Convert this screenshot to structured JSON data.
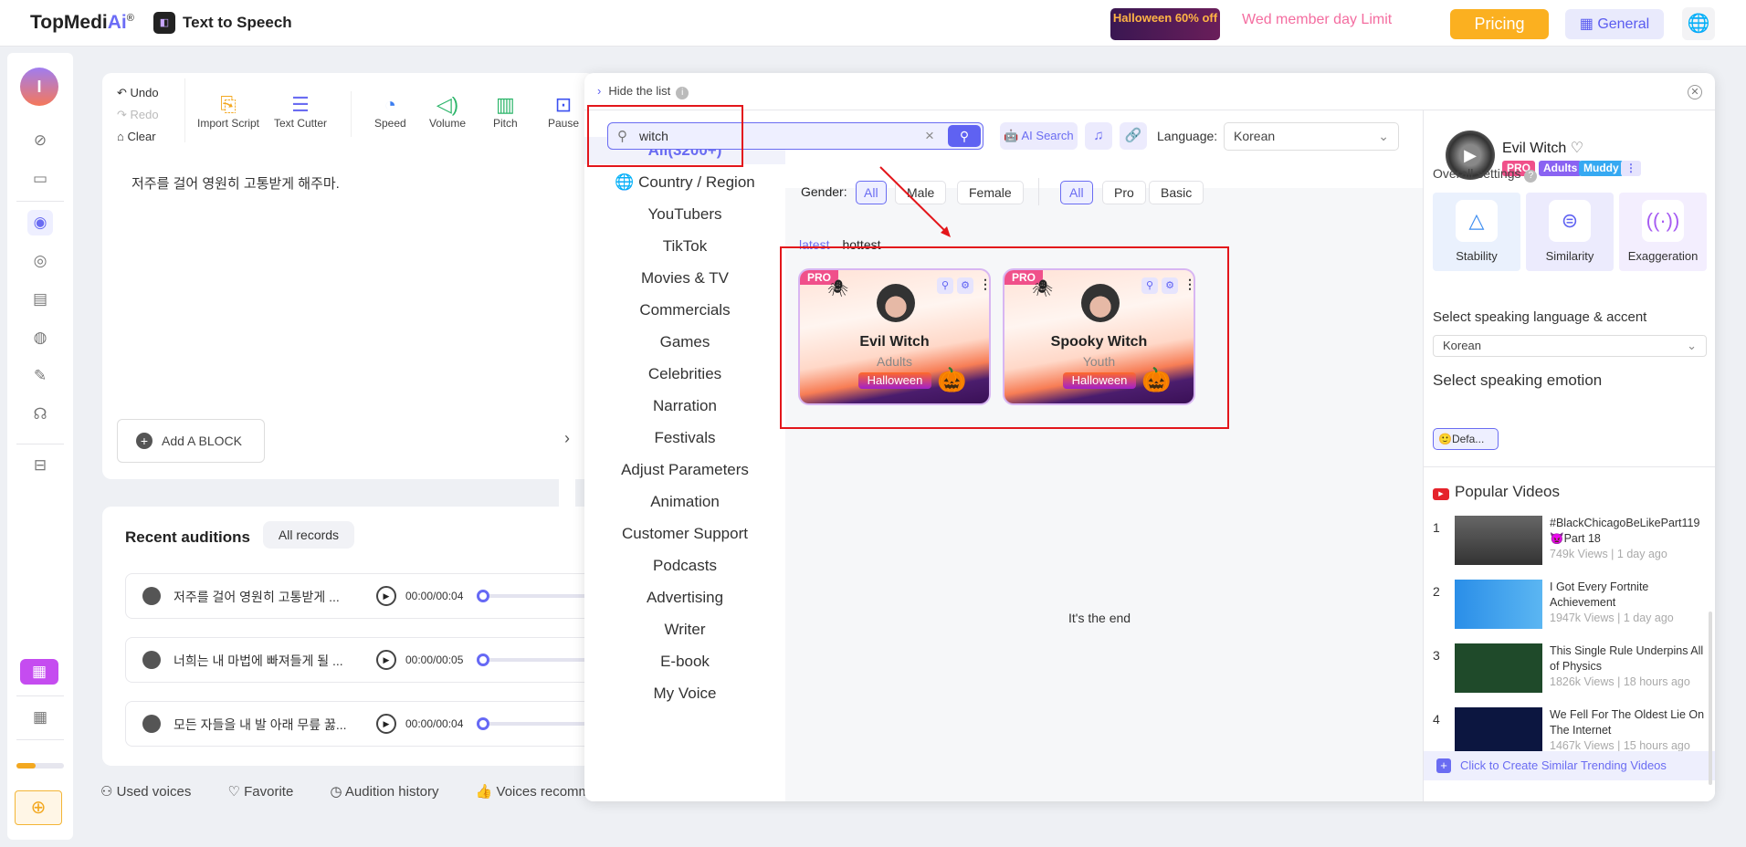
{
  "header": {
    "brand": "TopMedi",
    "brand_ai": "Ai",
    "registered": "®",
    "app_title": "Text to Speech",
    "promo": "Halloween 60% off",
    "member_banner": "Wed member day Limit",
    "pricing": "Pricing",
    "general": "General"
  },
  "sidebar": {
    "avatar_letter": "I",
    "icons": [
      "theme-icon",
      "folder-icon",
      "text-to-speech-icon",
      "voice-changer-icon",
      "audio-icon",
      "voice-cloning-icon",
      "podcast-icon",
      "speaker-icon",
      "toolbox-icon",
      "calendar-icon",
      "apps-icon",
      "add-icon"
    ],
    "usage_fraction": 0.4
  },
  "editor": {
    "toolbar": {
      "undo": "Undo",
      "redo": "Redo",
      "clear": "Clear",
      "import": "Import Script",
      "cutter": "Text Cutter",
      "speed": "Speed",
      "volume": "Volume",
      "pitch": "Pitch",
      "pause": "Pause"
    },
    "text": "저주를 걸어 영원히 고통받게 해주마.",
    "add_block": "Add A BLOCK"
  },
  "auditions": {
    "title": "Recent auditions",
    "all_records": "All records",
    "rows": [
      {
        "text": "저주를 걸어 영원히 고통받게 ...",
        "time": "00:00/00:04"
      },
      {
        "text": "너희는 내 마법에 빠져들게 될 ...",
        "time": "00:00/00:05"
      },
      {
        "text": "모든 자들을 내 발 아래 무릎 꿇...",
        "time": "00:00/00:04"
      }
    ]
  },
  "bottom_links": {
    "used": "Used voices",
    "favorite": "Favorite",
    "history": "Audition history",
    "recommended": "Voices recommended"
  },
  "modal": {
    "hide_list": "Hide the list",
    "search": {
      "value": "witch",
      "ai_search": "AI Search",
      "language_label": "Language:",
      "language": "Korean"
    },
    "categories": [
      "All(3200+)",
      "Country / Region",
      "YouTubers",
      "TikTok",
      "Movies & TV",
      "Commercials",
      "Games",
      "Celebrities",
      "Narration",
      "Festivals",
      "Adjust Parameters",
      "Animation",
      "Customer Support",
      "Podcasts",
      "Advertising",
      "Writer",
      "E-book",
      "My Voice"
    ],
    "filters": {
      "gender_label": "Gender:",
      "gender": [
        "All",
        "Male",
        "Female"
      ],
      "tier": [
        "All",
        "Pro",
        "Basic"
      ]
    },
    "sort": {
      "latest": "latest",
      "hottest": "hottest"
    },
    "voices": [
      {
        "badge": "PRO",
        "name": "Evil Witch",
        "age": "Adults",
        "tag": "Halloween"
      },
      {
        "badge": "PRO",
        "name": "Spooky Witch",
        "age": "Youth",
        "tag": "Halloween"
      }
    ],
    "end_text": "It's the end",
    "detail": {
      "name": "Evil Witch",
      "badges": [
        "PRO",
        "Adults",
        "Muddy"
      ],
      "overall": "Overall settings",
      "settings": [
        "Stability",
        "Similarity",
        "Exaggeration"
      ],
      "lang_label": "Select speaking language & accent",
      "lang": "Korean",
      "emotion_label": "Select speaking emotion",
      "emotion": "Defa...",
      "popular_title": "Popular Videos",
      "videos": [
        {
          "n": "1",
          "title": "#BlackChicagoBeLikePart119 👿Part 18",
          "meta": "749k Views | 1 day ago"
        },
        {
          "n": "2",
          "title": "I Got Every Fortnite Achievement",
          "meta": "1947k Views | 1 day ago"
        },
        {
          "n": "3",
          "title": "This Single Rule Underpins All of Physics",
          "meta": "1826k Views | 18 hours ago"
        },
        {
          "n": "4",
          "title": "We Fell For The Oldest Lie On The Internet",
          "meta": "1467k Views | 15 hours ago"
        }
      ],
      "create": "Click to Create Similar Trending Videos"
    }
  },
  "colors": {
    "accent": "#6a6cf2",
    "pricing": "#fbb020",
    "annotation": "#e3161b",
    "pro": "#f0508a"
  }
}
